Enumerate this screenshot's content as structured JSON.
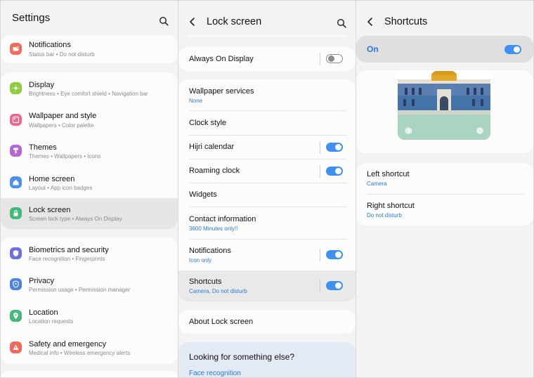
{
  "settings": {
    "title": "Settings",
    "items": [
      {
        "label": "Notifications",
        "sub": "Status bar  •  Do not disturb",
        "color": "#f26b5b"
      },
      {
        "label": "Display",
        "sub": "Brightness  •  Eye comfort shield  •  Navigation bar",
        "color": "#8ccf3a"
      },
      {
        "label": "Wallpaper and style",
        "sub": "Wallpapers  •  Color palette",
        "color": "#f0658e"
      },
      {
        "label": "Themes",
        "sub": "Themes  •  Wallpapers  •  Icons",
        "color": "#b667d3"
      },
      {
        "label": "Home screen",
        "sub": "Layout  •  App icon badges",
        "color": "#4a90ec"
      },
      {
        "label": "Lock screen",
        "sub": "Screen lock type  •  Always On Display",
        "color": "#43b97b"
      },
      {
        "label": "Biometrics and security",
        "sub": "Face recognition  •  Fingerprints",
        "color": "#6b6fe0"
      },
      {
        "label": "Privacy",
        "sub": "Permission usage  •  Permission manager",
        "color": "#4a82e6"
      },
      {
        "label": "Location",
        "sub": "Location requests",
        "color": "#43b97b"
      },
      {
        "label": "Safety and emergency",
        "sub": "Medical info  •  Wireless emergency alerts",
        "color": "#ef6a5a"
      }
    ]
  },
  "lockscreen": {
    "title": "Lock screen",
    "always_on": {
      "label": "Always On Display",
      "on": false
    },
    "items": [
      {
        "label": "Wallpaper services",
        "sub": "None"
      },
      {
        "label": "Clock style",
        "sub": ""
      },
      {
        "label": "Hijri calendar",
        "sub": "",
        "on": true
      },
      {
        "label": "Roaming clock",
        "sub": "",
        "on": true
      },
      {
        "label": "Widgets",
        "sub": ""
      },
      {
        "label": "Contact information",
        "sub": "3600 Minutes only!!"
      },
      {
        "label": "Notifications",
        "sub": "Icon only",
        "on": true
      },
      {
        "label": "Shortcuts",
        "sub": "Camera, Do not disturb",
        "on": true
      }
    ],
    "about": "About Lock screen",
    "looking": {
      "title": "Looking for something else?",
      "link": "Face recognition"
    }
  },
  "shortcuts": {
    "title": "Shortcuts",
    "master": {
      "label": "On",
      "on": true
    },
    "left": {
      "label": "Left shortcut",
      "value": "Camera"
    },
    "right": {
      "label": "Right shortcut",
      "value": "Do not disturb"
    }
  },
  "colors": {
    "accent": "#3e91f2",
    "link": "#2a7ad6"
  }
}
